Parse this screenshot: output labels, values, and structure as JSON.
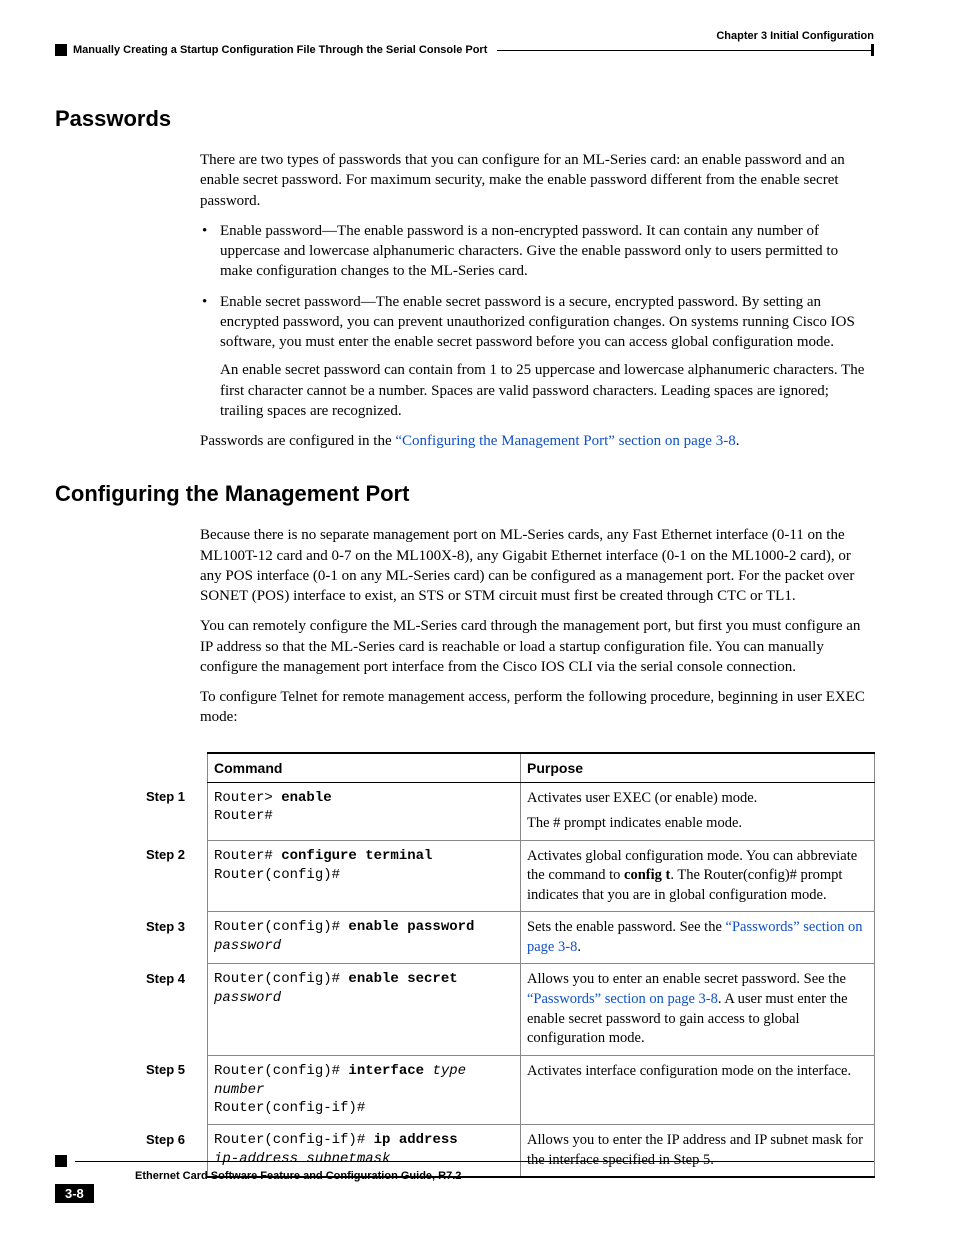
{
  "header": {
    "chapter": "Chapter 3      Initial Configuration",
    "subtitle": "Manually Creating a Startup Configuration File Through the Serial Console Port"
  },
  "section1": {
    "title": "Passwords",
    "intro": "There are two types of passwords that you can configure for an ML-Series card: an enable password and an enable secret password. For maximum security, make the enable password different from the enable secret password.",
    "bullet1": "Enable password—The enable password is a non-encrypted password. It can contain any number of uppercase and lowercase alphanumeric characters. Give the enable password only to users permitted to make configuration changes to the ML-Series card.",
    "bullet2": "Enable secret password—The enable secret password is a secure, encrypted password. By setting an encrypted password, you can prevent unauthorized configuration changes. On systems running Cisco IOS software, you must enter the enable secret password before you can access global configuration mode.",
    "bullet2_sub": "An enable secret password can contain from 1 to 25 uppercase and lowercase alphanumeric characters. The first character cannot be a number. Spaces are valid password characters. Leading spaces are ignored; trailing spaces are recognized.",
    "closing_pre": "Passwords are configured in the ",
    "closing_link": "“Configuring the Management Port” section on page 3-8",
    "closing_post": "."
  },
  "section2": {
    "title": "Configuring the Management Port",
    "p1": "Because there is no separate management port on ML-Series cards, any Fast Ethernet interface (0-11 on the ML100T-12 card and 0-7 on the ML100X-8), any Gigabit Ethernet interface (0-1 on the ML1000-2 card), or any POS interface (0-1 on any ML-Series card) can be configured as a management port. For the packet over SONET (POS) interface to exist, an STS or STM circuit must first be created through CTC or TL1.",
    "p2": "You can remotely configure the ML-Series card through the management port, but first you must configure an IP address so that the ML-Series card is reachable or load a startup configuration file. You can manually configure the management port interface from the Cisco IOS CLI via the serial console connection.",
    "p3": "To configure Telnet for remote management access, perform the following procedure, beginning in user EXEC mode:"
  },
  "table": {
    "head_command": "Command",
    "head_purpose": "Purpose",
    "rows": [
      {
        "step": "Step 1",
        "cmd_html": "Router&gt; <b>enable</b><br>Router#",
        "purpose_html": "<p>Activates user EXEC (or enable) mode.</p><p>The # prompt indicates enable mode.</p>"
      },
      {
        "step": "Step 2",
        "cmd_html": "Router# <b>configure terminal</b><br>Router(config)#",
        "purpose_html": "Activates global configuration mode. You can abbreviate the command to <b>config t</b>. The Router(config)# prompt indicates that you are in global configuration mode."
      },
      {
        "step": "Step 3",
        "cmd_html": "Router(config)# <b>enable password</b><br><i>password</i>",
        "purpose_html": "Sets the enable password. See the <a class='xref' href='#'>“Passwords” section on page 3-8</a>."
      },
      {
        "step": "Step 4",
        "cmd_html": "Router(config)# <b>enable secret</b> <i>password</i>",
        "purpose_html": "Allows you to enter an enable secret password. See the <a class='xref' href='#'>“Passwords” section on page 3-8</a>. A user must enter the enable secret password to gain access to global configuration mode."
      },
      {
        "step": "Step 5",
        "cmd_html": "Router(config)# <b>interface</b> <i>type number</i><br>Router(config-if)#",
        "purpose_html": "Activates interface configuration mode on the interface."
      },
      {
        "step": "Step 6",
        "cmd_html": "Router(config-if)# <b>ip address</b><br><i>ip-address subnetmask</i>",
        "purpose_html": "Allows you to enter the IP address and IP subnet mask for the interface specified in Step 5."
      }
    ]
  },
  "footer": {
    "title": "Ethernet Card Software Feature and Configuration Guide, R7.2",
    "pagenum": "3-8"
  }
}
